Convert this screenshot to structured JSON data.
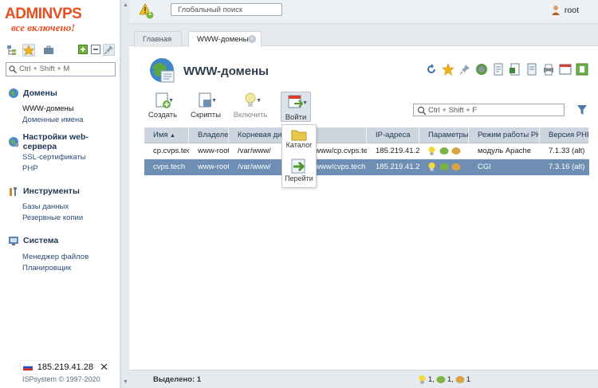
{
  "brand": {
    "logo_text": "ADMINVPS",
    "tagline": "все включено!",
    "accent": "#e6501e"
  },
  "sidebar": {
    "search_placeholder": "Ctrl + Shift + M",
    "groups": [
      {
        "label": "Домены",
        "items": [
          {
            "label": "WWW-домены",
            "selected": true
          },
          {
            "label": "Доменные имена"
          }
        ]
      },
      {
        "label": "Настройки web-сервера",
        "items": [
          {
            "label": "SSL-сертификаты"
          },
          {
            "label": "PHP"
          }
        ]
      },
      {
        "label": "Инструменты",
        "items": [
          {
            "label": "Базы данных"
          },
          {
            "label": "Резервные копии"
          }
        ]
      },
      {
        "label": "Система",
        "items": [
          {
            "label": "Менеджер файлов"
          },
          {
            "label": "Планировщик"
          }
        ]
      }
    ],
    "server_ip": "185.219.41.28",
    "copyright": "ISPsystem © 1997-2020"
  },
  "topbar": {
    "search_placeholder": "Глобальный поиск",
    "notification_count": "1",
    "user": "root"
  },
  "tabs": [
    {
      "label": "Главная"
    },
    {
      "label": "WWW-домены",
      "active": true
    }
  ],
  "page": {
    "title": "WWW-домены"
  },
  "toolbar": {
    "create": "Создать",
    "scripts": "Скрипты",
    "enable": "Включить",
    "enter": "Войти",
    "filter_placeholder": "Ctrl + Shift + F"
  },
  "dropdown": {
    "catalog": "Каталог",
    "go": "Перейти"
  },
  "table": {
    "columns": [
      "Имя",
      "Владелец",
      "Корневая директория",
      "IP-адреса",
      "Параметры",
      "Режим работы PHP",
      "Версия PHP"
    ],
    "rows": [
      {
        "name": "cp.cvps.tec",
        "owner": "www-root",
        "root_a": "/var/www/",
        "root_b": "www/cp.cvps.tec",
        "ip": "185.219.41.28",
        "php_mode": "модуль Apache",
        "php_version": "7.1.33 (alt)"
      },
      {
        "name": "cvps.tech",
        "owner": "www-root",
        "root_a": "/var/www/",
        "root_b": "www/cvps.tech",
        "ip": "185.219.41.28",
        "php_mode": "CGI",
        "php_version": "7.3.16 (alt)",
        "selected": true
      }
    ]
  },
  "status": {
    "selected": "Выделено: 1",
    "count_a": "1,",
    "count_b": "1,",
    "count_c": "1"
  },
  "colors": {
    "header_bg": "#cdd6df",
    "selected_row": "#6f8eb3",
    "link": "#2c4b76"
  }
}
